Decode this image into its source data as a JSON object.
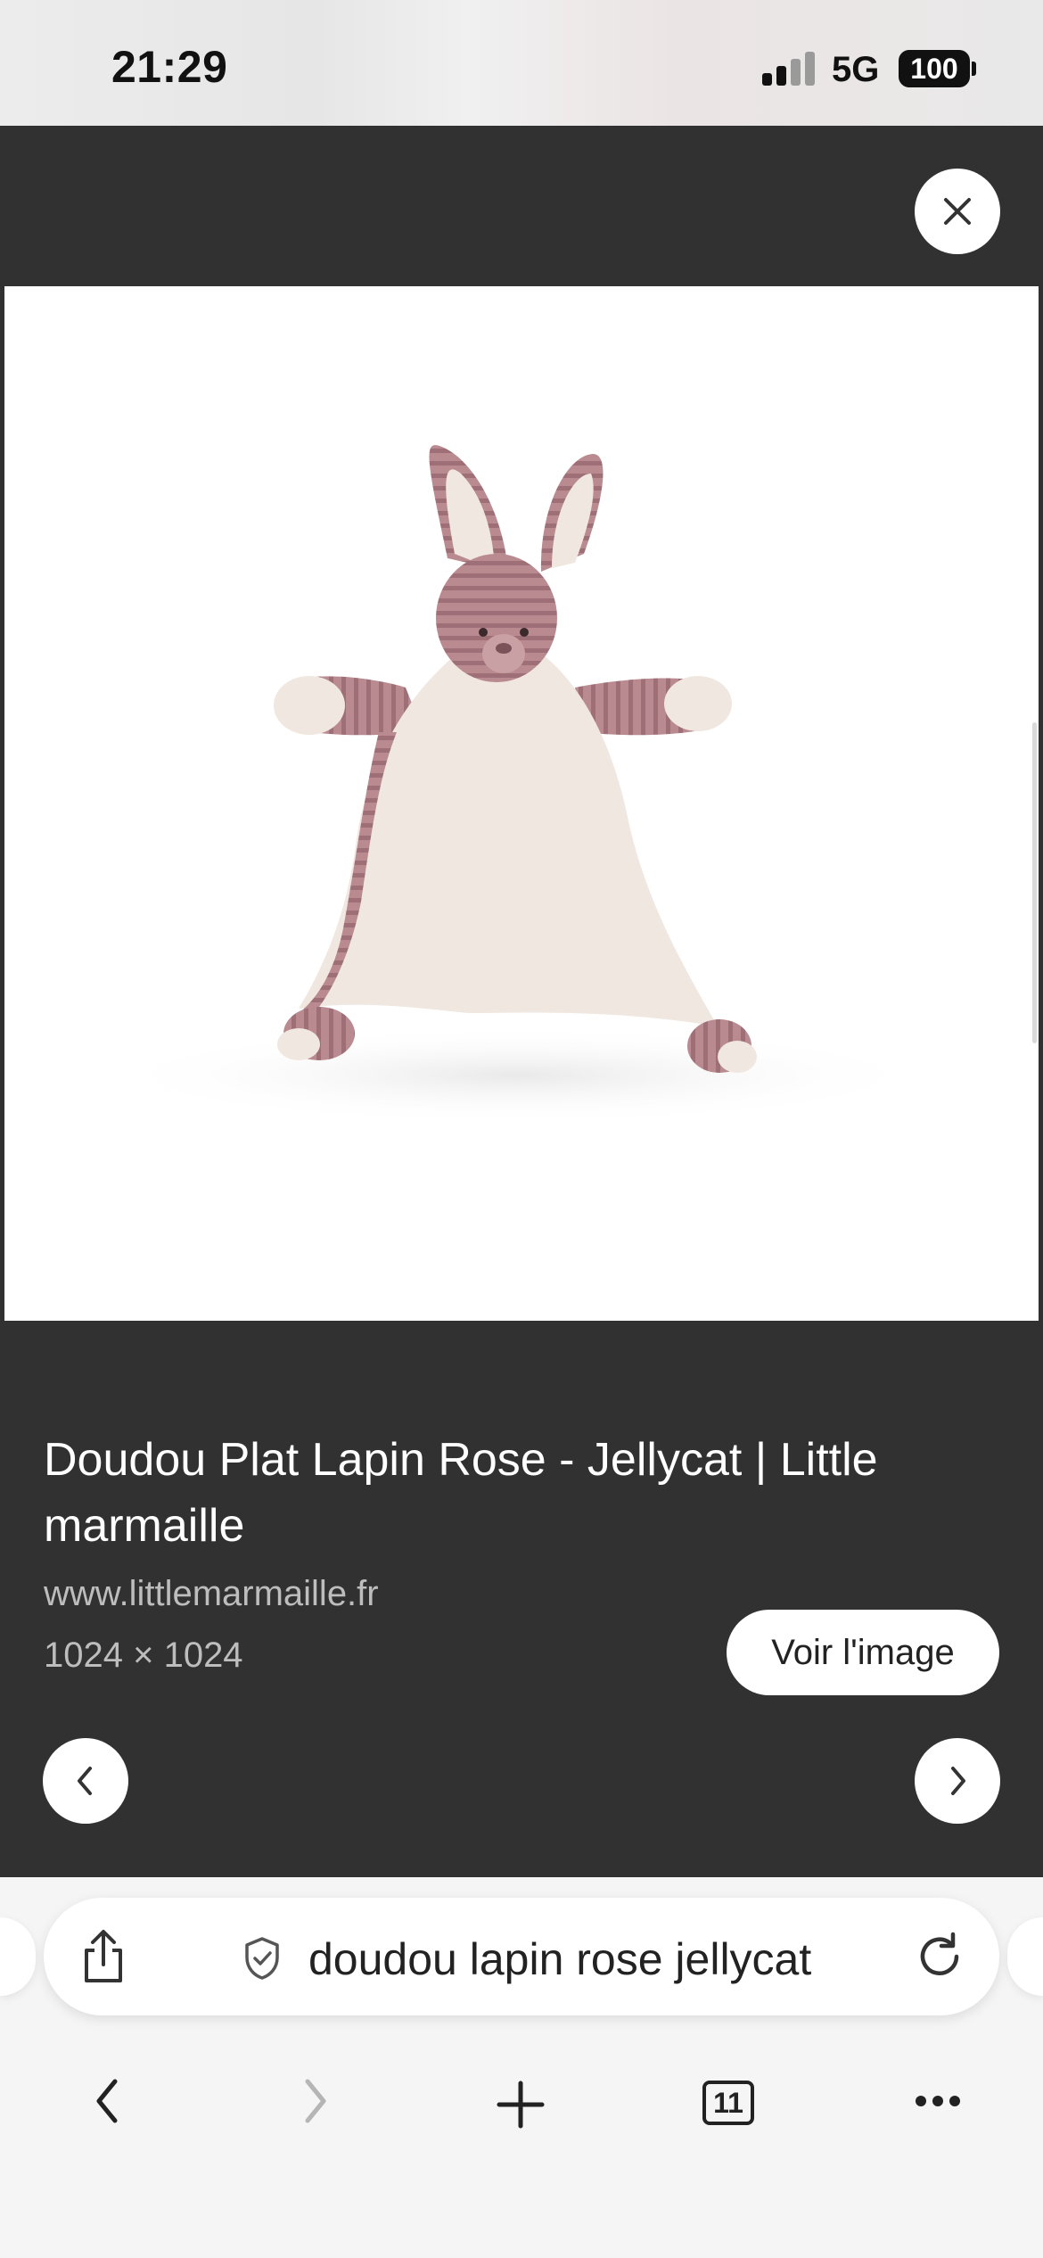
{
  "status_bar": {
    "time": "21:29",
    "network": "5G",
    "battery": "100"
  },
  "image_viewer": {
    "title": "Doudou Plat Lapin Rose - Jellycat | Little marmaille",
    "domain": "www.littlemarmaille.fr",
    "dimensions": "1024 × 1024",
    "view_image_label": "Voir l'image",
    "close_icon": "close-icon",
    "prev_icon": "chevron-left-icon",
    "next_icon": "chevron-right-icon"
  },
  "browser": {
    "search_query": "doudou lapin rose jellycat",
    "tab_count": "11",
    "toolbar_icons": [
      "back-icon",
      "forward-icon",
      "new-tab-icon",
      "tabs-icon",
      "more-icon"
    ],
    "url_bar_icons": [
      "share-icon",
      "shield-check-icon",
      "reload-icon"
    ]
  },
  "colors": {
    "viewer_background": "#313131",
    "plush_pink": "#b98a8f",
    "plush_cream": "#efe7e0"
  }
}
